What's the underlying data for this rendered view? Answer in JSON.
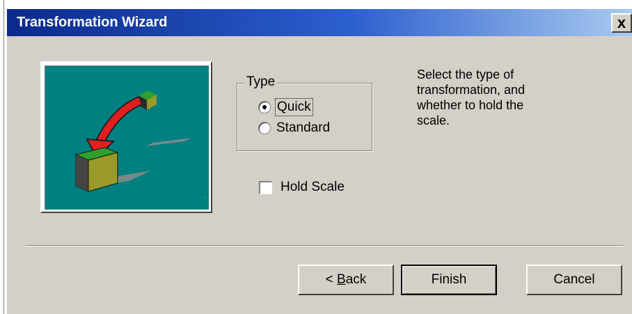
{
  "window": {
    "title": "Transformation Wizard",
    "close_label": "x"
  },
  "picture": {
    "icon": "cube-transform-illustration"
  },
  "type_group": {
    "label": "Type",
    "options": [
      {
        "label": "Quick",
        "checked": true
      },
      {
        "label": "Standard",
        "checked": false
      }
    ]
  },
  "hold_scale": {
    "label": "Hold Scale",
    "checked": false
  },
  "instructions": {
    "text": "Select the type of\ntransformation, and\nwhether to hold the\nscale."
  },
  "buttons": {
    "back_prefix": "< ",
    "back_mnemonic": "B",
    "back_rest": "ack",
    "finish": "Finish",
    "cancel": "Cancel"
  }
}
